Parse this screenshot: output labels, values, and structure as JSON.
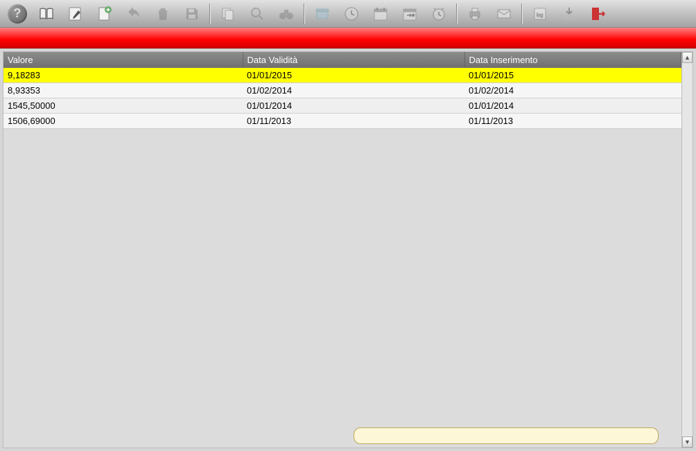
{
  "toolbar": {
    "icons": [
      "help",
      "book",
      "edit",
      "new-doc",
      "undo",
      "trash",
      "save",
      "sep",
      "copy",
      "search",
      "binoculars",
      "sep",
      "archive",
      "clock",
      "calendar",
      "calendar-go",
      "alarm",
      "sep",
      "print",
      "mail",
      "sep",
      "log",
      "download",
      "exit"
    ]
  },
  "table": {
    "columns": [
      "Valore",
      "Data Validità",
      "Data Inserimento"
    ],
    "rows": [
      {
        "valore": "9,18283",
        "validita": "01/01/2015",
        "inserimento": "01/01/2015",
        "selected": true
      },
      {
        "valore": "8,93353",
        "validita": "01/02/2014",
        "inserimento": "01/02/2014",
        "selected": false
      },
      {
        "valore": "1545,50000",
        "validita": "01/01/2014",
        "inserimento": "01/01/2014",
        "selected": false
      },
      {
        "valore": "1506,69000",
        "validita": "01/11/2013",
        "inserimento": "01/11/2013",
        "selected": false
      }
    ]
  },
  "footer": {
    "value": ""
  }
}
